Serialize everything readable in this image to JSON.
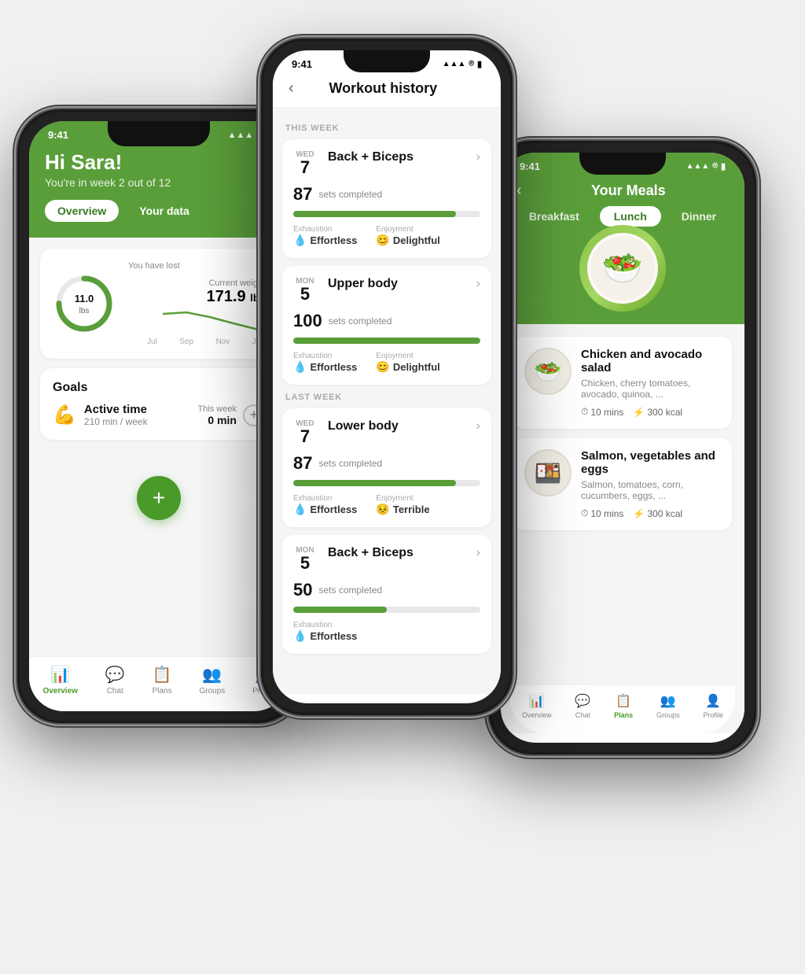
{
  "leftPhone": {
    "statusBar": {
      "time": "9:41",
      "signal": "●●●●",
      "wifi": "wifi",
      "battery": "battery"
    },
    "header": {
      "greeting": "Hi Sara!",
      "subtitle": "You're in week 2 out of 12",
      "tabs": [
        {
          "label": "Overview",
          "active": true
        },
        {
          "label": "Your data",
          "active": false
        }
      ]
    },
    "weightCard": {
      "lostLabel": "You have lost",
      "lostValue": "11.0",
      "lostUnit": "lbs",
      "currentLabel": "Current weight",
      "currentValue": "171.9",
      "currentUnit": "lbs",
      "chartLabels": [
        "Jul",
        "Sep",
        "Nov",
        "Jan"
      ]
    },
    "goals": {
      "title": "Goals",
      "activeTime": {
        "emoji": "💪",
        "name": "Active time",
        "sub": "210 min / week",
        "weekLabel": "This week",
        "weekValue": "0 min"
      }
    },
    "fab": "+",
    "nav": [
      {
        "icon": "📊",
        "label": "Overview",
        "active": true
      },
      {
        "icon": "💬",
        "label": "Chat",
        "active": false
      },
      {
        "icon": "📋",
        "label": "Plans",
        "active": false
      },
      {
        "icon": "👥",
        "label": "Groups",
        "active": false
      },
      {
        "icon": "👤",
        "label": "Profile",
        "active": false
      }
    ]
  },
  "midPhone": {
    "statusBar": {
      "time": "9:41"
    },
    "title": "Workout history",
    "thisWeekLabel": "THIS WEEK",
    "lastWeekLabel": "LAST WEEK",
    "workouts": [
      {
        "section": "THIS WEEK",
        "dayLabel": "WED",
        "dayNum": "7",
        "name": "Back + Biceps",
        "percent": "87",
        "pctLabel": "sets completed",
        "barWidth": "87",
        "exhaustion": "Effortless",
        "exhaustionEmoji": "💧",
        "enjoyment": "Delightful",
        "enjoymentEmoji": "😊"
      },
      {
        "section": "THIS WEEK",
        "dayLabel": "MON",
        "dayNum": "5",
        "name": "Upper body",
        "percent": "100",
        "pctLabel": "sets completed",
        "barWidth": "100",
        "exhaustion": "Effortless",
        "exhaustionEmoji": "💧",
        "enjoyment": "Delightful",
        "enjoymentEmoji": "😊"
      },
      {
        "section": "LAST WEEK",
        "dayLabel": "WED",
        "dayNum": "7",
        "name": "Lower body",
        "percent": "87",
        "pctLabel": "sets completed",
        "barWidth": "87",
        "exhaustion": "Effortless",
        "exhaustionEmoji": "💧",
        "enjoyment": "Terrible",
        "enjoymentEmoji": "😣"
      },
      {
        "section": "LAST WEEK",
        "dayLabel": "MON",
        "dayNum": "5",
        "name": "Back + Biceps",
        "percent": "50",
        "pctLabel": "sets completed",
        "barWidth": "50",
        "exhaustion": "Effortless",
        "exhaustionEmoji": "💧",
        "enjoyment": "",
        "enjoymentEmoji": ""
      }
    ]
  },
  "rightPhone": {
    "statusBar": {
      "time": "9:41"
    },
    "title": "Your Meals",
    "tabs": [
      {
        "label": "Breakfast",
        "active": false
      },
      {
        "label": "Lunch",
        "active": true
      },
      {
        "label": "Dinner",
        "active": false
      }
    ],
    "meals": [
      {
        "name": "Chicken and avocado salad",
        "desc": "Chicken, cherry tomatoes, avocado, quinoa, ...",
        "time": "10 mins",
        "calories": "300 kcal",
        "emoji": "🥗"
      },
      {
        "name": "Salmon, vegetables and eggs",
        "desc": "Salmon, tomatoes, corn, cucumbers, eggs, ...",
        "time": "10 mins",
        "calories": "300 kcal",
        "emoji": "🍱"
      }
    ],
    "nav": [
      {
        "icon": "📊",
        "label": "Overview",
        "active": false
      },
      {
        "icon": "💬",
        "label": "Chat",
        "active": false
      },
      {
        "icon": "📋",
        "label": "Plans",
        "active": true
      },
      {
        "icon": "👥",
        "label": "Groups",
        "active": false
      },
      {
        "icon": "👤",
        "label": "Profile",
        "active": false
      }
    ]
  }
}
